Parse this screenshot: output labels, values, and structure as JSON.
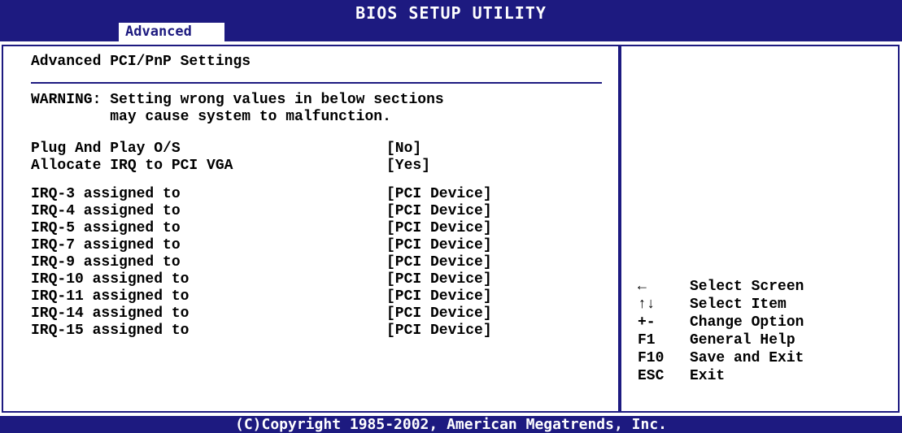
{
  "title": "BIOS SETUP UTILITY",
  "active_tab": "Advanced",
  "section_title": "Advanced PCI/PnP Settings",
  "warning": {
    "line1": "WARNING: Setting wrong values in below sections",
    "line2": "         may cause system to malfunction."
  },
  "settings": [
    {
      "label": "Plug And Play O/S",
      "value": "[No]"
    },
    {
      "label": "Allocate IRQ to PCI VGA",
      "value": "[Yes]"
    },
    {
      "label": "IRQ-3 assigned to",
      "value": "[PCI Device]"
    },
    {
      "label": "IRQ-4 assigned to",
      "value": "[PCI Device]"
    },
    {
      "label": "IRQ-5 assigned to",
      "value": "[PCI Device]"
    },
    {
      "label": "IRQ-7 assigned to",
      "value": "[PCI Device]"
    },
    {
      "label": "IRQ-9 assigned to",
      "value": "[PCI Device]"
    },
    {
      "label": "IRQ-10 assigned to",
      "value": "[PCI Device]"
    },
    {
      "label": "IRQ-11 assigned to",
      "value": "[PCI Device]"
    },
    {
      "label": "IRQ-14 assigned to",
      "value": "[PCI Device]"
    },
    {
      "label": "IRQ-15 assigned to",
      "value": "[PCI Device]"
    }
  ],
  "help": [
    {
      "key": "←",
      "desc": "Select Screen"
    },
    {
      "key": "↑↓",
      "desc": "Select Item"
    },
    {
      "key": "+-",
      "desc": "Change Option"
    },
    {
      "key": "F1",
      "desc": "General Help"
    },
    {
      "key": "F10",
      "desc": "Save and Exit"
    },
    {
      "key": "ESC",
      "desc": "Exit"
    }
  ],
  "footer": "(C)Copyright 1985-2002, American Megatrends, Inc.",
  "colors": {
    "frame": "#1d1a80",
    "background": "#ffffff",
    "text": "#000000"
  }
}
